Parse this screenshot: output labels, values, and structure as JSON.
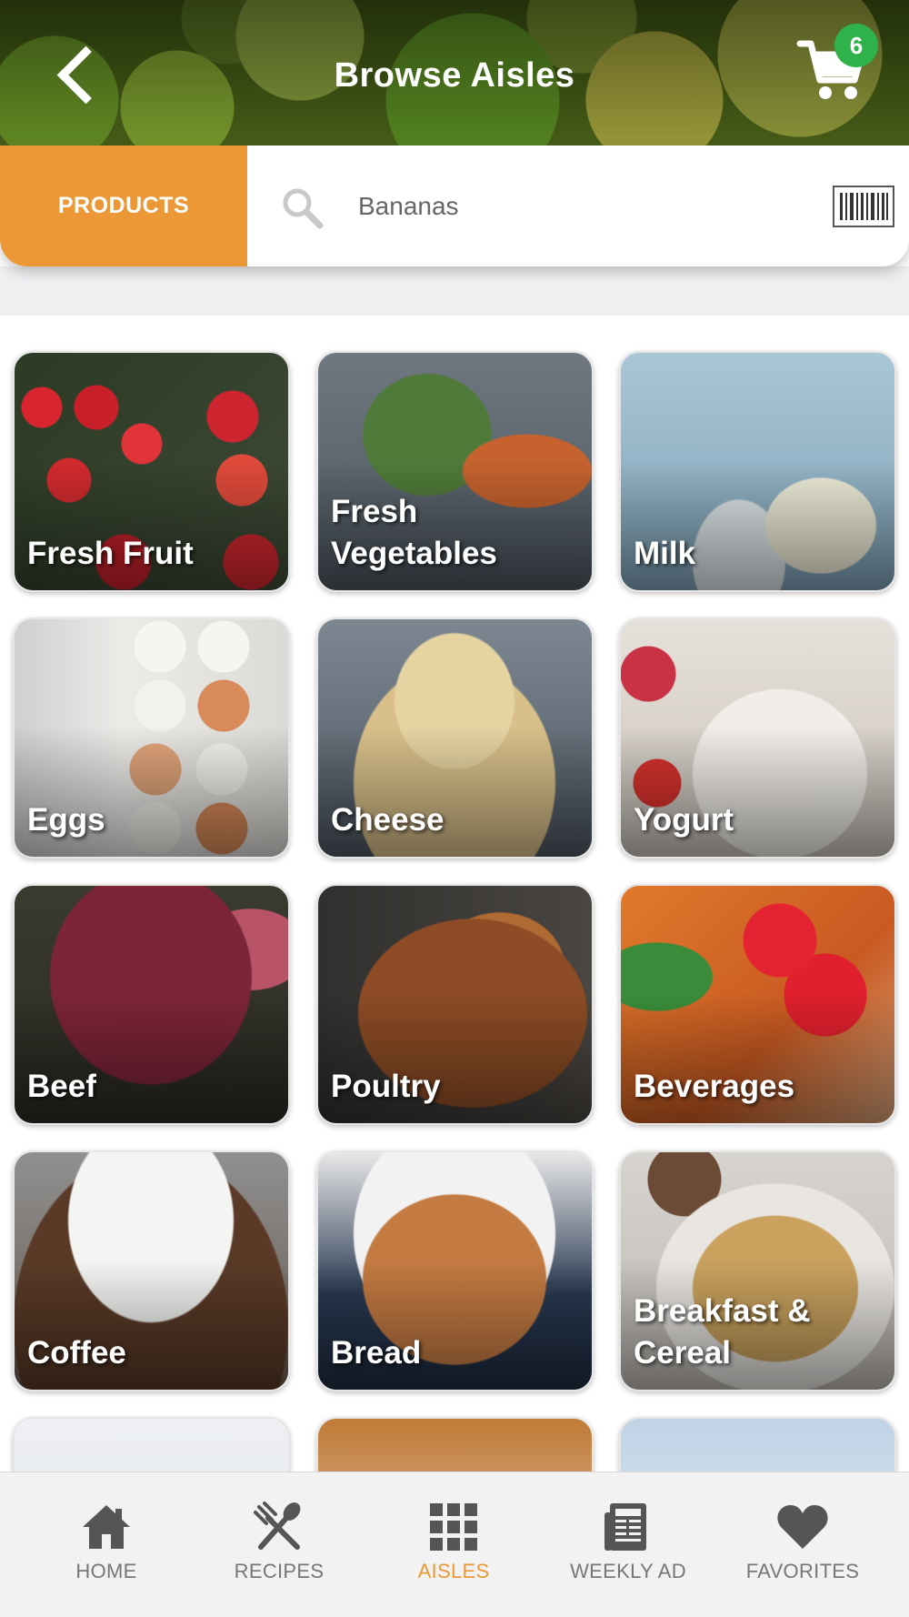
{
  "header": {
    "title": "Browse Aisles",
    "cart_count": "6"
  },
  "search": {
    "tab_label": "PRODUCTS",
    "value": "Bananas"
  },
  "aisles": [
    {
      "label": "Fresh Fruit"
    },
    {
      "label": "Fresh Vegetables"
    },
    {
      "label": "Milk"
    },
    {
      "label": "Eggs"
    },
    {
      "label": "Cheese"
    },
    {
      "label": "Yogurt"
    },
    {
      "label": "Beef"
    },
    {
      "label": "Poultry"
    },
    {
      "label": "Beverages"
    },
    {
      "label": "Coffee"
    },
    {
      "label": "Bread"
    },
    {
      "label": "Breakfast & Cereal"
    }
  ],
  "nav": {
    "items": [
      {
        "label": "HOME",
        "icon": "home-icon"
      },
      {
        "label": "RECIPES",
        "icon": "utensils-icon"
      },
      {
        "label": "AISLES",
        "icon": "grid-icon",
        "active": true
      },
      {
        "label": "WEEKLY AD",
        "icon": "newspaper-icon"
      },
      {
        "label": "FAVORITES",
        "icon": "heart-icon"
      }
    ]
  },
  "colors": {
    "accent": "#ec9836",
    "badge": "#2fb24a",
    "nav_text": "#777777"
  }
}
